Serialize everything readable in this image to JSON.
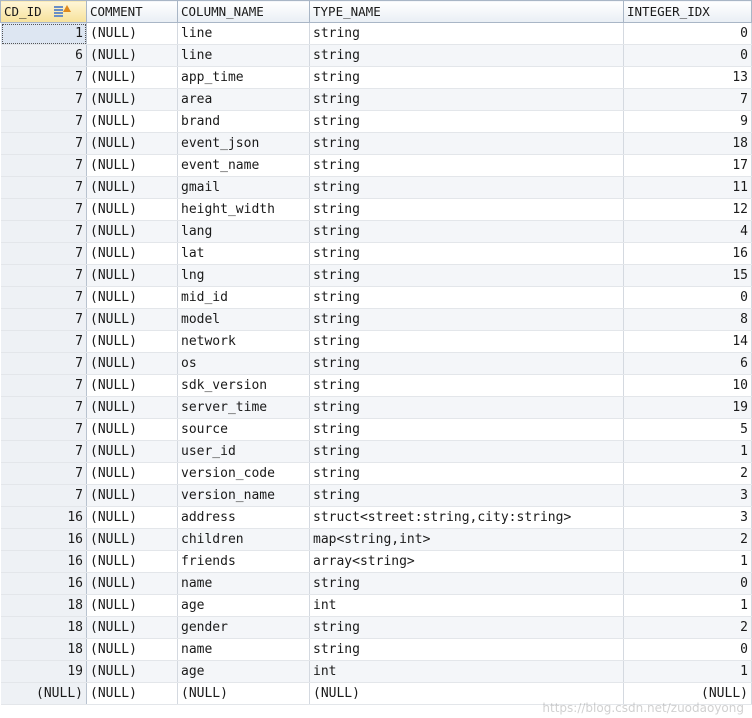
{
  "columns": [
    "CD_ID",
    "COMMENT",
    "COLUMN_NAME",
    "TYPE_NAME",
    "INTEGER_IDX"
  ],
  "sorted_column": "CD_ID",
  "rows": [
    [
      "1",
      "(NULL)",
      "line",
      "string",
      "0"
    ],
    [
      "6",
      "(NULL)",
      "line",
      "string",
      "0"
    ],
    [
      "7",
      "(NULL)",
      "app_time",
      "string",
      "13"
    ],
    [
      "7",
      "(NULL)",
      "area",
      "string",
      "7"
    ],
    [
      "7",
      "(NULL)",
      "brand",
      "string",
      "9"
    ],
    [
      "7",
      "(NULL)",
      "event_json",
      "string",
      "18"
    ],
    [
      "7",
      "(NULL)",
      "event_name",
      "string",
      "17"
    ],
    [
      "7",
      "(NULL)",
      "gmail",
      "string",
      "11"
    ],
    [
      "7",
      "(NULL)",
      "height_width",
      "string",
      "12"
    ],
    [
      "7",
      "(NULL)",
      "lang",
      "string",
      "4"
    ],
    [
      "7",
      "(NULL)",
      "lat",
      "string",
      "16"
    ],
    [
      "7",
      "(NULL)",
      "lng",
      "string",
      "15"
    ],
    [
      "7",
      "(NULL)",
      "mid_id",
      "string",
      "0"
    ],
    [
      "7",
      "(NULL)",
      "model",
      "string",
      "8"
    ],
    [
      "7",
      "(NULL)",
      "network",
      "string",
      "14"
    ],
    [
      "7",
      "(NULL)",
      "os",
      "string",
      "6"
    ],
    [
      "7",
      "(NULL)",
      "sdk_version",
      "string",
      "10"
    ],
    [
      "7",
      "(NULL)",
      "server_time",
      "string",
      "19"
    ],
    [
      "7",
      "(NULL)",
      "source",
      "string",
      "5"
    ],
    [
      "7",
      "(NULL)",
      "user_id",
      "string",
      "1"
    ],
    [
      "7",
      "(NULL)",
      "version_code",
      "string",
      "2"
    ],
    [
      "7",
      "(NULL)",
      "version_name",
      "string",
      "3"
    ],
    [
      "16",
      "(NULL)",
      "address",
      "struct<street:string,city:string>",
      "3"
    ],
    [
      "16",
      "(NULL)",
      "children",
      "map<string,int>",
      "2"
    ],
    [
      "16",
      "(NULL)",
      "friends",
      "array<string>",
      "1"
    ],
    [
      "16",
      "(NULL)",
      "name",
      "string",
      "0"
    ],
    [
      "18",
      "(NULL)",
      "age",
      "int",
      "1"
    ],
    [
      "18",
      "(NULL)",
      "gender",
      "string",
      "2"
    ],
    [
      "18",
      "(NULL)",
      "name",
      "string",
      "0"
    ],
    [
      "19",
      "(NULL)",
      "age",
      "int",
      "1"
    ],
    [
      "(NULL)",
      "(NULL)",
      "(NULL)",
      "(NULL)",
      "(NULL)"
    ]
  ],
  "watermark": "https://blog.csdn.net/zuodaoyong"
}
